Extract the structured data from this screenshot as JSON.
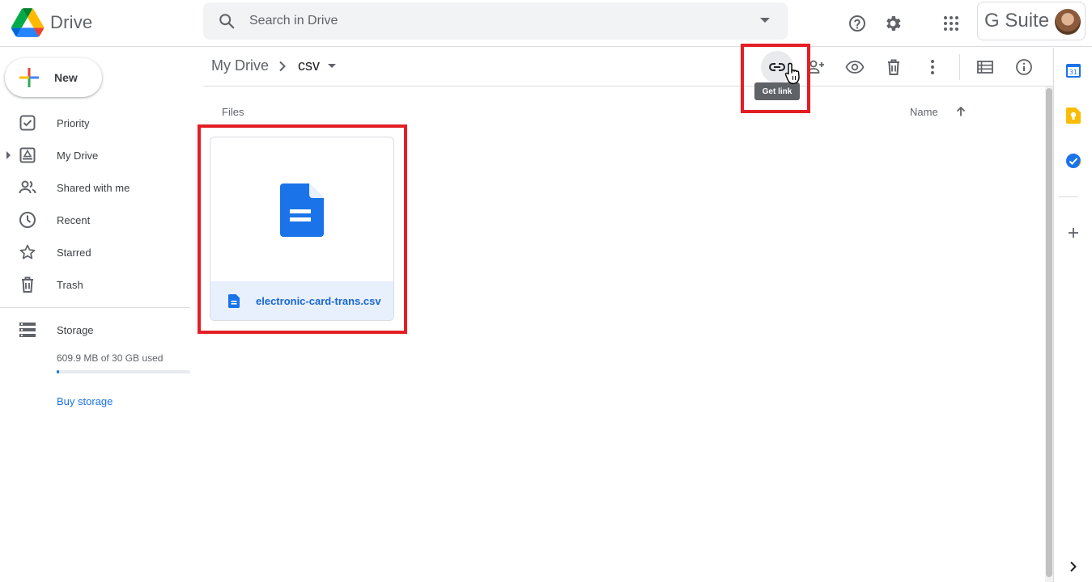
{
  "app": {
    "name": "Drive"
  },
  "search": {
    "placeholder": "Search in Drive"
  },
  "header": {
    "gsuite_label": "G Suite"
  },
  "sidebar": {
    "new_label": "New",
    "items": [
      {
        "label": "Priority",
        "icon": "priority-check-icon"
      },
      {
        "label": "My Drive",
        "icon": "my-drive-icon"
      },
      {
        "label": "Shared with me",
        "icon": "shared-people-icon"
      },
      {
        "label": "Recent",
        "icon": "clock-icon"
      },
      {
        "label": "Starred",
        "icon": "star-icon"
      },
      {
        "label": "Trash",
        "icon": "trash-icon"
      }
    ],
    "storage": {
      "label": "Storage",
      "used_text": "609.9 MB of 30 GB used",
      "used_fraction": 0.0203,
      "buy_label": "Buy storage"
    }
  },
  "breadcrumb": {
    "root": "My Drive",
    "current": "csv"
  },
  "toolbar": {
    "tooltip": "Get link",
    "buttons": [
      "link-icon",
      "add-person-icon",
      "eye-icon",
      "trash-icon",
      "more-vert-icon",
      "list-view-icon",
      "info-icon"
    ]
  },
  "content": {
    "section_label": "Files",
    "sort_label": "Name",
    "files": [
      {
        "name": "electronic-card-trans.csv",
        "icon": "doc-icon"
      }
    ]
  },
  "colors": {
    "accent": "#1a73e8",
    "highlight": "#e31e24",
    "file_selected_bg": "#e8f0fe"
  }
}
